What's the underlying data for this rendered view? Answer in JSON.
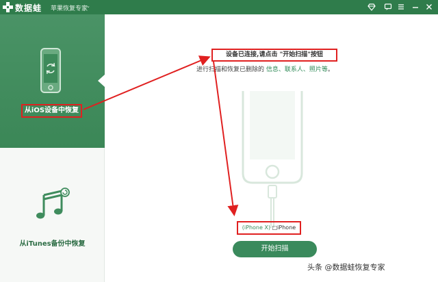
{
  "app": {
    "logo_text": "数据蛙",
    "subtitle": "苹果恢复专家",
    "subtitle_caret": "⌄"
  },
  "titlebar_icons": [
    "diamond-icon",
    "feedback-icon",
    "menu-icon",
    "minimize-icon",
    "close-icon"
  ],
  "sidebar": {
    "items": [
      {
        "label": "从iOS设备中恢复",
        "active": true,
        "icon": "iphone-sync-icon"
      },
      {
        "label": "从iTunes备份中恢复",
        "active": false,
        "icon": "music-restore-icon"
      }
    ]
  },
  "main": {
    "instruction_line1": "设备已连接,请点击 \"开始扫描\"按钮",
    "instruction_line2_prefix": "进行扫描和恢复已删除的 ",
    "instruction_line2_items": "信息、联系人、照片等",
    "instruction_line2_suffix": "。",
    "device_model": "(iPhone X)",
    "device_name": "□iPhone",
    "start_button": "开始扫描"
  },
  "watermark": "头条 @数据蛙恢复专家",
  "colors": {
    "brand_green": "#2f7c4b",
    "sidebar_active": "#3b8757",
    "button_green": "#3a8a5c",
    "annotation_red": "#e02020"
  }
}
